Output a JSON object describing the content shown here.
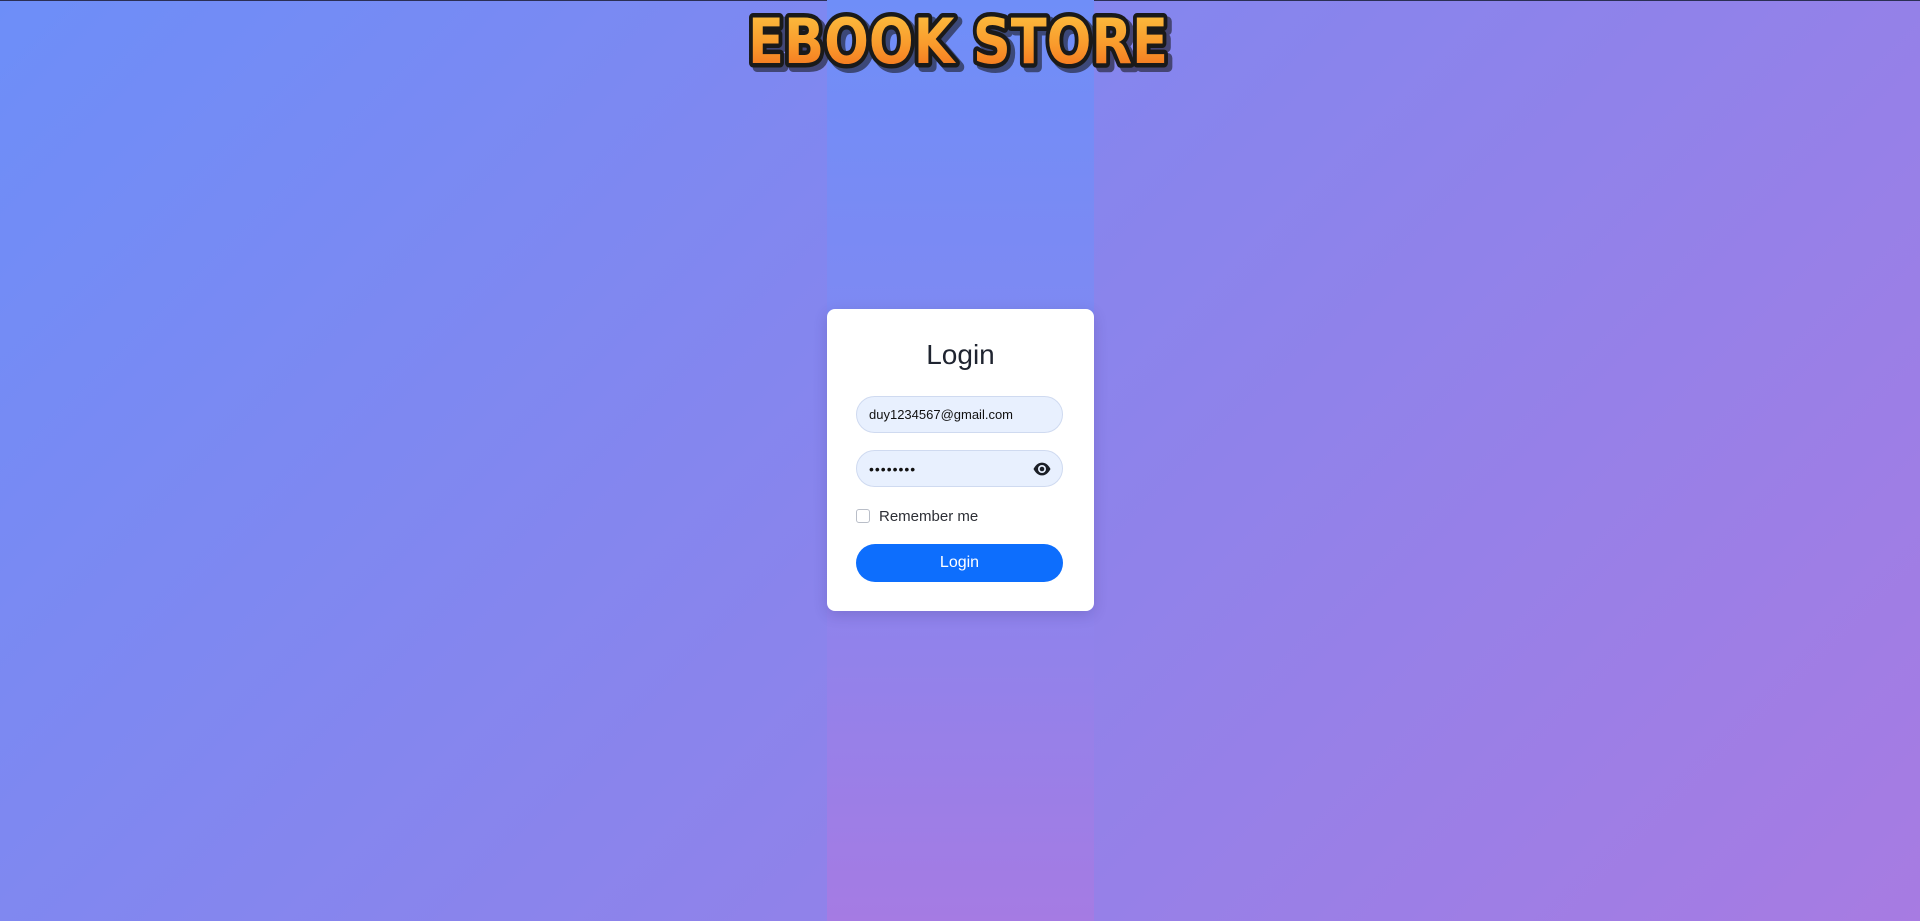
{
  "app": {
    "logo_text": "EBOOK STORE"
  },
  "login": {
    "title": "Login",
    "email_value": "duy1234567@gmail.com",
    "password_masked": "••••••••",
    "remember_label": "Remember me",
    "remember_checked": false,
    "submit_label": "Login"
  },
  "icons": {
    "password_toggle": "eye-icon"
  },
  "colors": {
    "button": "#0d6efd",
    "card": "#ffffff",
    "field_background": "#e8f0fe",
    "logo_fill": "#f99a2c",
    "logo_outline": "#1a1a1a",
    "gradient_start": "#6d8ef8",
    "gradient_end": "#a77be2"
  }
}
